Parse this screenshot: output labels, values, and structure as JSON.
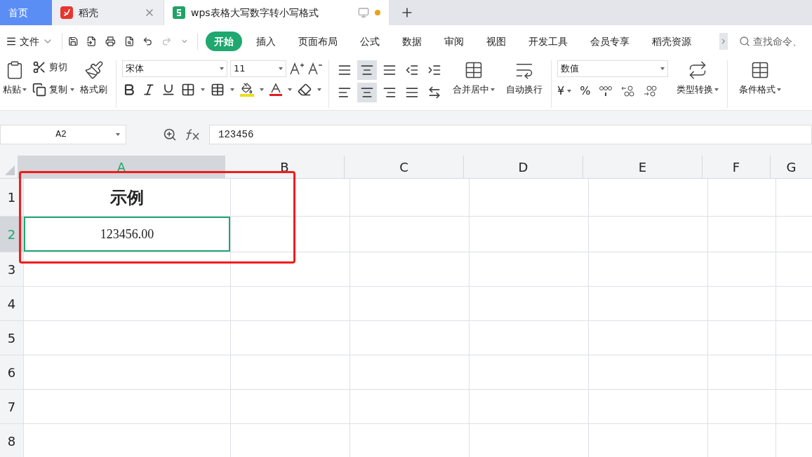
{
  "tabs": [
    {
      "label": "首页",
      "kind": "home",
      "selected": false
    },
    {
      "label": "稻壳",
      "kind": "docer",
      "selected": false
    },
    {
      "label": "wps表格大写数字转小写格式",
      "kind": "sheet",
      "selected": true,
      "unsaved": true
    }
  ],
  "menu": {
    "file": "文件",
    "tabs": [
      {
        "label": "开始",
        "selected": true
      },
      {
        "label": "插入",
        "selected": false
      },
      {
        "label": "页面布局",
        "selected": false
      },
      {
        "label": "公式",
        "selected": false
      },
      {
        "label": "数据",
        "selected": false
      },
      {
        "label": "审阅",
        "selected": false
      },
      {
        "label": "视图",
        "selected": false
      },
      {
        "label": "开发工具",
        "selected": false
      },
      {
        "label": "会员专享",
        "selected": false
      },
      {
        "label": "稻壳资源",
        "selected": false
      }
    ],
    "search_placeholder": "查找命令、"
  },
  "ribbon": {
    "paste": "粘贴",
    "cut": "剪切",
    "copy": "复制",
    "painter": "格式刷",
    "font_name": "宋体",
    "font_size": "11",
    "vertical_align": [
      {
        "kind": "top",
        "selected": false
      },
      {
        "kind": "middle",
        "selected": true
      },
      {
        "kind": "bottom",
        "selected": false
      }
    ],
    "horizontal_align": [
      {
        "kind": "left",
        "selected": false
      },
      {
        "kind": "center",
        "selected": true
      },
      {
        "kind": "right",
        "selected": false
      }
    ],
    "merge": "合并居中",
    "wrap": "自动换行",
    "number_format": "数值",
    "currency": "¥",
    "percent": "%",
    "convert": "类型转换",
    "conditional": "条件格式"
  },
  "formula_bar": {
    "cell_ref": "A2",
    "value": "123456"
  },
  "sheet": {
    "columns": [
      {
        "label": "A",
        "selected": true
      },
      {
        "label": "B",
        "selected": false
      },
      {
        "label": "C",
        "selected": false
      },
      {
        "label": "D",
        "selected": false
      },
      {
        "label": "E",
        "selected": false
      },
      {
        "label": "F",
        "selected": false
      },
      {
        "label": "G",
        "selected": false
      }
    ],
    "rows": [
      {
        "label": "1",
        "selected": false,
        "cells": [
          {
            "text": "示例",
            "kind": "title",
            "selected": false
          }
        ]
      },
      {
        "label": "2",
        "selected": true,
        "cells": [
          {
            "text": "123456.00",
            "kind": "number",
            "selected": true
          }
        ]
      },
      {
        "label": "3",
        "selected": false,
        "cells": []
      },
      {
        "label": "4",
        "selected": false,
        "cells": []
      },
      {
        "label": "5",
        "selected": false,
        "cells": []
      },
      {
        "label": "6",
        "selected": false,
        "cells": []
      },
      {
        "label": "7",
        "selected": false,
        "cells": []
      },
      {
        "label": "8",
        "selected": false,
        "cells": []
      }
    ]
  }
}
